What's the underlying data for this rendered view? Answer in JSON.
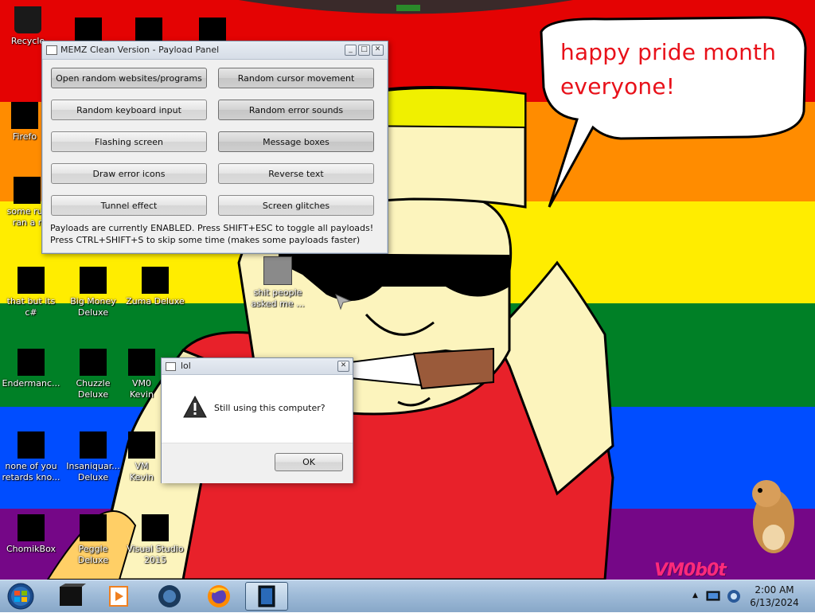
{
  "wallpaper": {
    "speech": "happy pride month\neveryone!",
    "watermark": "VM0b0t",
    "stripe_colors": [
      "#e40303",
      "#ff8c00",
      "#ffed00",
      "#008026",
      "#004dff",
      "#750787"
    ]
  },
  "desktop_icons": [
    {
      "label": "Recycle",
      "icon": "recycle-bin-icon"
    },
    {
      "label": "Firefo",
      "icon": "firefox-icon"
    },
    {
      "label": "some rus\nran a r",
      "icon": "folder-icon"
    },
    {
      "label": "that but its c#",
      "icon": "folder-icon"
    },
    {
      "label": "Big Money\nDeluxe",
      "icon": "money-bag-icon"
    },
    {
      "label": "Zuma Deluxe",
      "icon": "zuma-icon"
    },
    {
      "label": "Endermanc...",
      "icon": "terminal-icon"
    },
    {
      "label": "Chuzzle\nDeluxe",
      "icon": "chuzzle-icon"
    },
    {
      "label": "VM0\nKevin",
      "icon": "app-icon"
    },
    {
      "label": "none of you\nretards kno...",
      "icon": "app-icon"
    },
    {
      "label": "Insaniquar...\nDeluxe",
      "icon": "fish-icon"
    },
    {
      "label": "VM\nKevin",
      "icon": "app-icon"
    },
    {
      "label": "ChomikBox",
      "icon": "chomikbox-icon"
    },
    {
      "label": "Peggle Deluxe",
      "icon": "peggle-icon"
    },
    {
      "label": "Visual Studio\n2015",
      "icon": "visual-studio-icon"
    },
    {
      "label": "shit people\nasked me ...",
      "icon": "folder-icon"
    }
  ],
  "payload_panel": {
    "title": "MEMZ Clean Version - Payload Panel",
    "buttons": [
      "Open random websites/programs",
      "Random cursor movement",
      "Random keyboard input",
      "Random error sounds",
      "Flashing screen",
      "Message boxes",
      "Draw error icons",
      "Reverse text",
      "Tunnel effect",
      "Screen glitches"
    ],
    "status_line1": "Payloads are currently ENABLED. Press SHIFT+ESC to toggle all payloads!",
    "status_line2": "Press CTRL+SHIFT+S to skip some time (makes some payloads faster)"
  },
  "lol_dialog": {
    "title": "lol",
    "message": "Still using this computer?",
    "ok_label": "OK",
    "icon": "warning-icon"
  },
  "taskbar": {
    "start_icon": "windows-start-icon",
    "pinned": [
      "app-black-box-icon",
      "media-player-icon",
      "vm-icon",
      "firefox-icon",
      "window-icon"
    ],
    "clock_time": "2:00 AM",
    "clock_date": "6/13/2024"
  }
}
